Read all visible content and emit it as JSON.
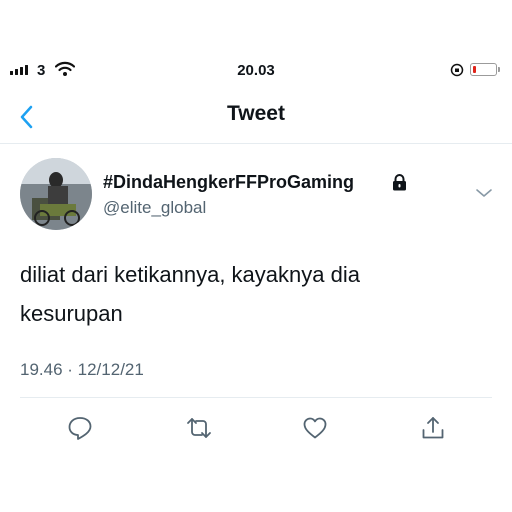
{
  "status_bar": {
    "carrier": "3",
    "time": "20.03",
    "battery_level": 0.15
  },
  "nav": {
    "title": "Tweet",
    "back_icon": "chevron-left-icon"
  },
  "tweet": {
    "display_name": "#DindaHengkerFFProGaming",
    "username": "@elite_global",
    "text_line1": "diliat dari ketikannya, kayaknya dia",
    "text_line2": "kesurupan",
    "timestamp": "19.46 · 12/12/21",
    "protected_icon": "lock-icon"
  },
  "actions": [
    "reply-icon",
    "retweet-icon",
    "like-icon",
    "share-icon"
  ],
  "colors": {
    "accent": "#1da1f2",
    "secondary_text": "#536471",
    "battery_low": "#e0251b"
  }
}
